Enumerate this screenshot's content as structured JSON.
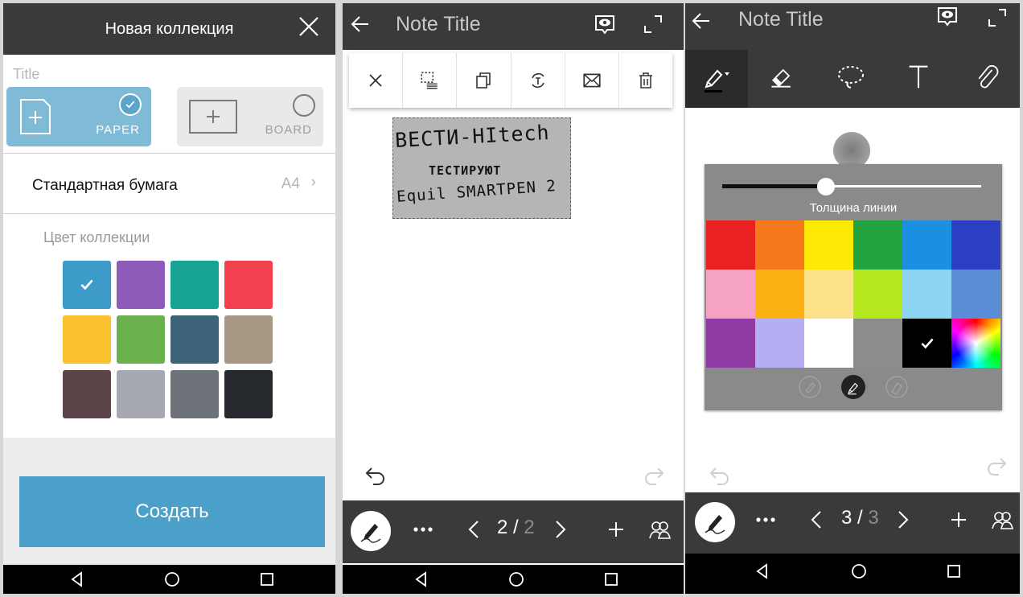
{
  "collection_panel": {
    "title": "Новая коллекция",
    "title_field_placeholder": "Title",
    "types": [
      {
        "label": "PAPER",
        "selected": true
      },
      {
        "label": "BOARD",
        "selected": false
      }
    ],
    "paper_label": "Стандартная бумага",
    "paper_size": "A4",
    "color_label": "Цвет коллекции",
    "colors": [
      "#3d9bc9",
      "#8e5bb8",
      "#17a392",
      "#f2404f",
      "#fbc02d",
      "#6ab04c",
      "#3d6378",
      "#a89883",
      "#5c4348",
      "#a7a9b0",
      "#6d7378",
      "#26292d"
    ],
    "selected_color_index": 0,
    "create_label": "Создать"
  },
  "note_panel_1": {
    "title": "Note Title",
    "page_current": "2",
    "page_total": "2",
    "handwriting": {
      "line1": "BECTИ-HItech",
      "line2": "TECTИРУЮТ",
      "line3": "Equil SMARTPEN 2"
    }
  },
  "note_panel_2": {
    "title": "Note Title",
    "page_current": "3",
    "page_total": "3",
    "thickness_label": "Толщина линии",
    "thickness_value_fraction": 0.4,
    "palette_colors": [
      "#e92121",
      "#f57a1b",
      "#fde905",
      "#22a33e",
      "#1b8fe0",
      "#2b3fc3",
      "#f6a2c3",
      "#fbb114",
      "#fce38a",
      "#b4e81f",
      "#8dd4f0",
      "#5b8ed8",
      "#8f3ba3",
      "#b6aef2",
      "#ffffff",
      "#8c8c8c",
      "#000000",
      "spectrum"
    ],
    "selected_palette_index": 16
  },
  "icons": {
    "close": "close-icon",
    "back": "arrow-left-icon",
    "view_mode": "eye-icon",
    "fullscreen": "fullscreen-icon",
    "pen": "pen-icon",
    "eraser": "eraser-icon",
    "lasso": "lasso-icon",
    "text": "text-icon",
    "attach": "paperclip-icon",
    "more": "more-icon",
    "add_page": "plus-icon",
    "share": "people-icon",
    "undo": "undo-icon",
    "redo": "redo-icon"
  },
  "separator": "/"
}
